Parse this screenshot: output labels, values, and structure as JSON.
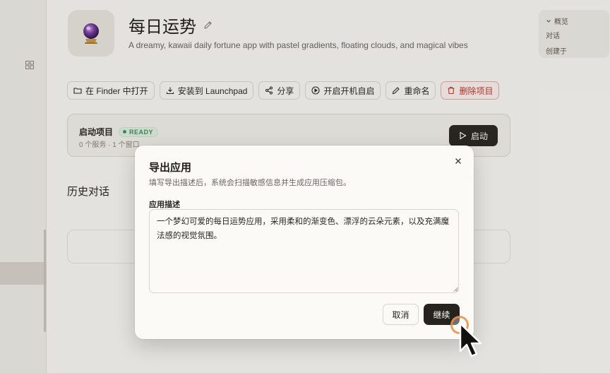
{
  "app": {
    "title": "每日运势",
    "subtitle": "A dreamy, kawaii daily fortune app with pastel gradients, floating clouds, and magical vibes"
  },
  "actions": [
    {
      "label": "在 Finder 中打开",
      "icon": "folder-icon"
    },
    {
      "label": "安装到 Launchpad",
      "icon": "download-icon"
    },
    {
      "label": "分享",
      "icon": "share-icon"
    },
    {
      "label": "开启开机自启",
      "icon": "play-circle-icon"
    },
    {
      "label": "重命名",
      "icon": "pencil-icon"
    },
    {
      "label": "删除项目",
      "icon": "trash-icon"
    }
  ],
  "launch": {
    "title": "启动项目",
    "status": "READY",
    "meta": "0 个服务 · 1 个窗口",
    "start_label": "启动"
  },
  "history": {
    "title": "历史对话"
  },
  "right_panel": {
    "heading": "概览",
    "items": [
      "对话",
      "创建于"
    ]
  },
  "dialog": {
    "title": "导出应用",
    "description": "填写导出描述后，系统会扫描敏感信息并生成应用压缩包。",
    "field_label": "应用描述",
    "field_value": "一个梦幻可爱的每日运势应用，采用柔和的渐变色、漂浮的云朵元素，以及充满魔法感的视觉氛围。",
    "cancel_label": "取消",
    "continue_label": "继续"
  },
  "colors": {
    "accent_dark": "#26221d",
    "danger": "#c2362c",
    "ready_green": "#3f8f58",
    "orb_purple": "#7b3fa8"
  }
}
